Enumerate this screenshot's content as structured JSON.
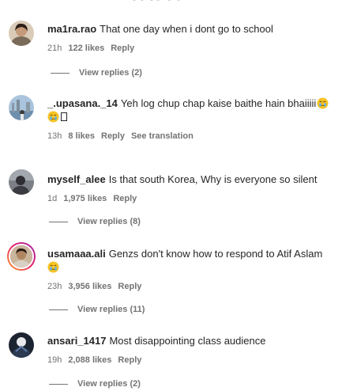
{
  "comments": [
    {
      "username": "ma1ra.rao",
      "text": "That one day when i dont go to school",
      "time": "21h",
      "likes": "122 likes",
      "reply": "Reply",
      "view_replies": "View replies (2)"
    },
    {
      "username": "_.upasana._14",
      "text": "Yeh log chup chap kaise baithe hain bhaiiiii",
      "time": "13h",
      "likes": "8 likes",
      "reply": "Reply",
      "see_translation": "See translation"
    },
    {
      "username": "myself_alee",
      "text": "Is that south Korea, Why is everyone so silent",
      "time": "1d",
      "likes": "1,975 likes",
      "reply": "Reply",
      "view_replies": "View replies (8)"
    },
    {
      "username": "usamaaa.ali",
      "text": "Genzs don't know how to respond to Atif Aslam",
      "time": "23h",
      "likes": "3,956 likes",
      "reply": "Reply",
      "view_replies": "View replies (11)"
    },
    {
      "username": "ansari_1417",
      "text": "Most disappointing class audience",
      "time": "19h",
      "likes": "2,088 likes",
      "reply": "Reply",
      "view_replies": "View replies (2)"
    }
  ],
  "icons": {
    "emoji": "crying-face-emoji",
    "missing_glyph": "missing-glyph-box"
  },
  "colors": {
    "text": "#262626",
    "secondary": "#737373",
    "story_ring": "#e1306c"
  }
}
